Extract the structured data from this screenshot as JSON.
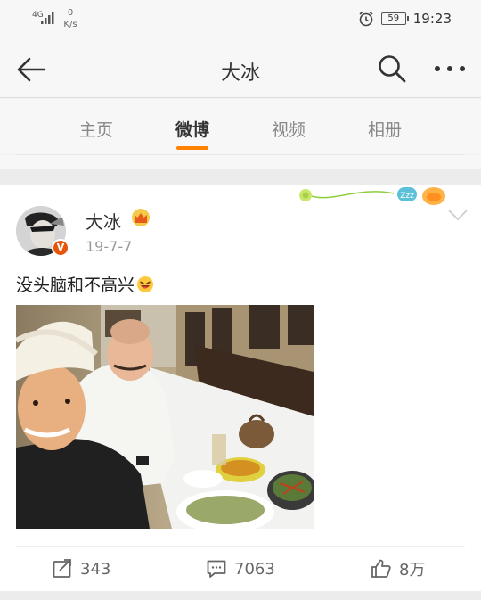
{
  "status_bar": {
    "signal_label": "4G",
    "net_speed_value": "0",
    "net_speed_unit": "K/s",
    "battery_level": "59",
    "time": "19:23"
  },
  "nav": {
    "title": "大冰"
  },
  "tabs": [
    {
      "label": "主页",
      "active": false
    },
    {
      "label": "微博",
      "active": true
    },
    {
      "label": "视频",
      "active": false
    },
    {
      "label": "相册",
      "active": false
    }
  ],
  "post": {
    "username": "大冰",
    "verified_badge": "V",
    "date": "19-7-7",
    "text": "没头脑和不高兴",
    "decoration_badge": "Zzz",
    "actions": {
      "repost_count": "343",
      "comment_count": "7063",
      "like_count": "8万"
    }
  },
  "colors": {
    "accent": "#ff8200",
    "verified": "#e8540a",
    "background": "#f2f2f2"
  }
}
